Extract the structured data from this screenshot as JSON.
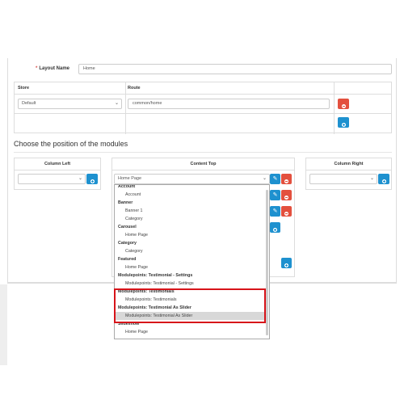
{
  "layout_name": {
    "label": "Layout Name",
    "required_mark": "*",
    "value": "Home"
  },
  "route_table": {
    "headers": {
      "store": "Store",
      "route": "Route"
    },
    "row": {
      "store": "Default",
      "route": "common/home"
    }
  },
  "section_title": "Choose the position of the modules",
  "columns": {
    "left": {
      "heading": "Column Left"
    },
    "top": {
      "heading": "Content Top",
      "selected": "Home Page"
    },
    "right": {
      "heading": "Column Right"
    }
  },
  "dropdown": {
    "items": [
      {
        "type": "group",
        "text": "Account"
      },
      {
        "type": "option",
        "text": "Account"
      },
      {
        "type": "group",
        "text": "Banner"
      },
      {
        "type": "option",
        "text": "Banner 1"
      },
      {
        "type": "option",
        "text": "Category"
      },
      {
        "type": "group",
        "text": "Carousel"
      },
      {
        "type": "option",
        "text": "Home Page"
      },
      {
        "type": "group",
        "text": "Category"
      },
      {
        "type": "option",
        "text": "Category"
      },
      {
        "type": "group",
        "text": "Featured"
      },
      {
        "type": "option",
        "text": "Home Page"
      },
      {
        "type": "group",
        "text": "Modulepoints: Testimonial - Settings"
      },
      {
        "type": "option",
        "text": "Modulepoints: Testimonial - Settings"
      },
      {
        "type": "group",
        "text": "Modulepoints: Testimonials"
      },
      {
        "type": "option",
        "text": "Modulepoints: Testimonials"
      },
      {
        "type": "group",
        "text": "Modulepoints: Testimonial As Slider"
      },
      {
        "type": "option",
        "text": "Modulepoints: Testimonial As Slider",
        "selected": true
      },
      {
        "type": "group",
        "text": "Slideshow"
      },
      {
        "type": "option",
        "text": "Home Page"
      }
    ]
  },
  "icons": {
    "remove": "minus-circle-icon",
    "add": "plus-circle-icon",
    "edit": "pencil-icon",
    "caret": "chevron-down-icon"
  },
  "colors": {
    "primary": "#1e91cf",
    "danger": "#e3503e",
    "highlight": "#d7141a"
  }
}
